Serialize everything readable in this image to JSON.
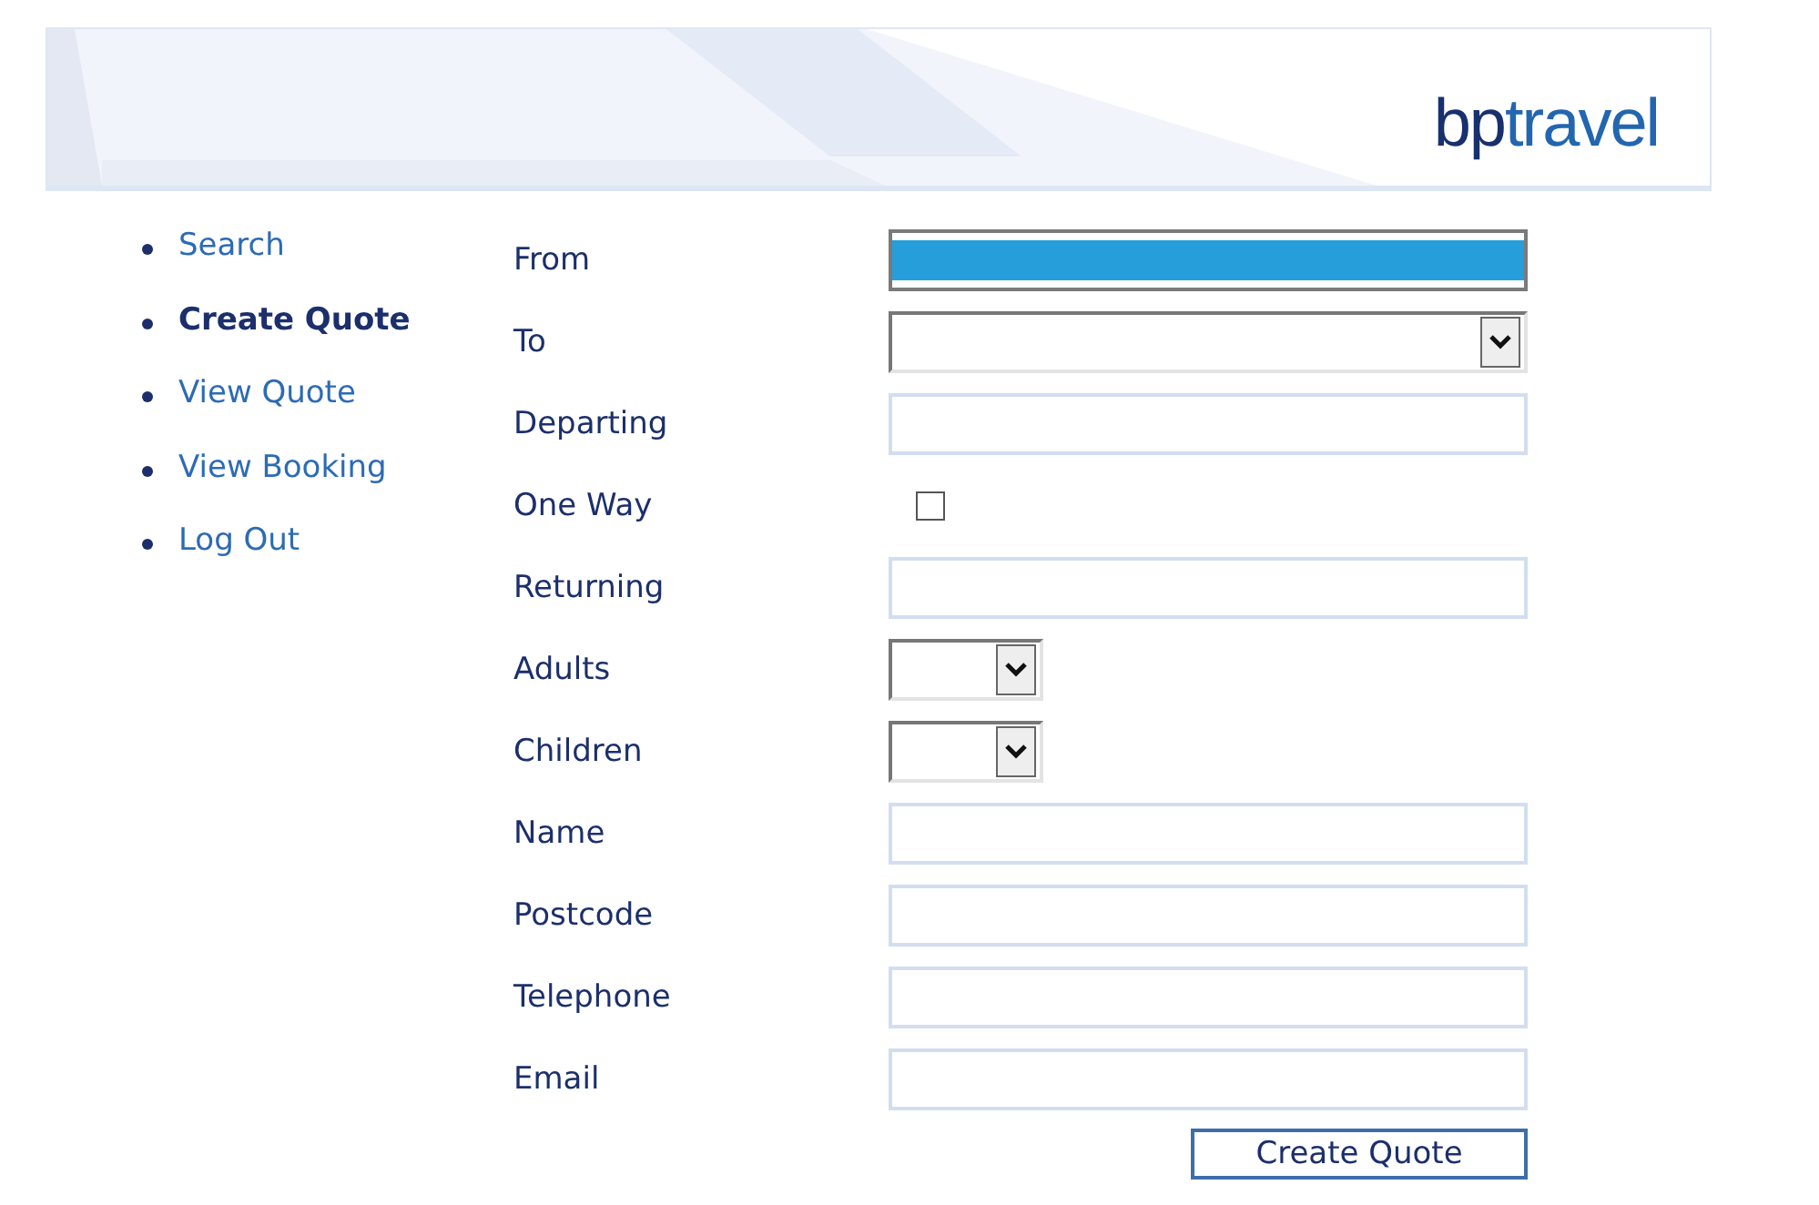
{
  "header": {
    "logo": {
      "dark_part": "bp",
      "light_part": "travel"
    }
  },
  "nav": [
    {
      "label": "Search",
      "selected": false
    },
    {
      "label": "Create Quote",
      "selected": true
    },
    {
      "label": "View Quote",
      "selected": false
    },
    {
      "label": "View Booking",
      "selected": false
    },
    {
      "label": "Log Out",
      "selected": false
    }
  ],
  "form": {
    "fields": [
      {
        "label": "From",
        "kind": "listbox"
      },
      {
        "label": "To",
        "kind": "combo"
      },
      {
        "label": "Departing",
        "kind": "text"
      },
      {
        "label": "One Way",
        "kind": "checkbox",
        "checked": false
      },
      {
        "label": "Returning",
        "kind": "text"
      },
      {
        "label": "Adults",
        "kind": "select"
      },
      {
        "label": "Children",
        "kind": "select"
      },
      {
        "label": "Name",
        "kind": "text"
      },
      {
        "label": "Postcode",
        "kind": "text"
      },
      {
        "label": "Telephone",
        "kind": "text"
      },
      {
        "label": "Email",
        "kind": "text"
      }
    ],
    "submit": "Create Quote"
  }
}
